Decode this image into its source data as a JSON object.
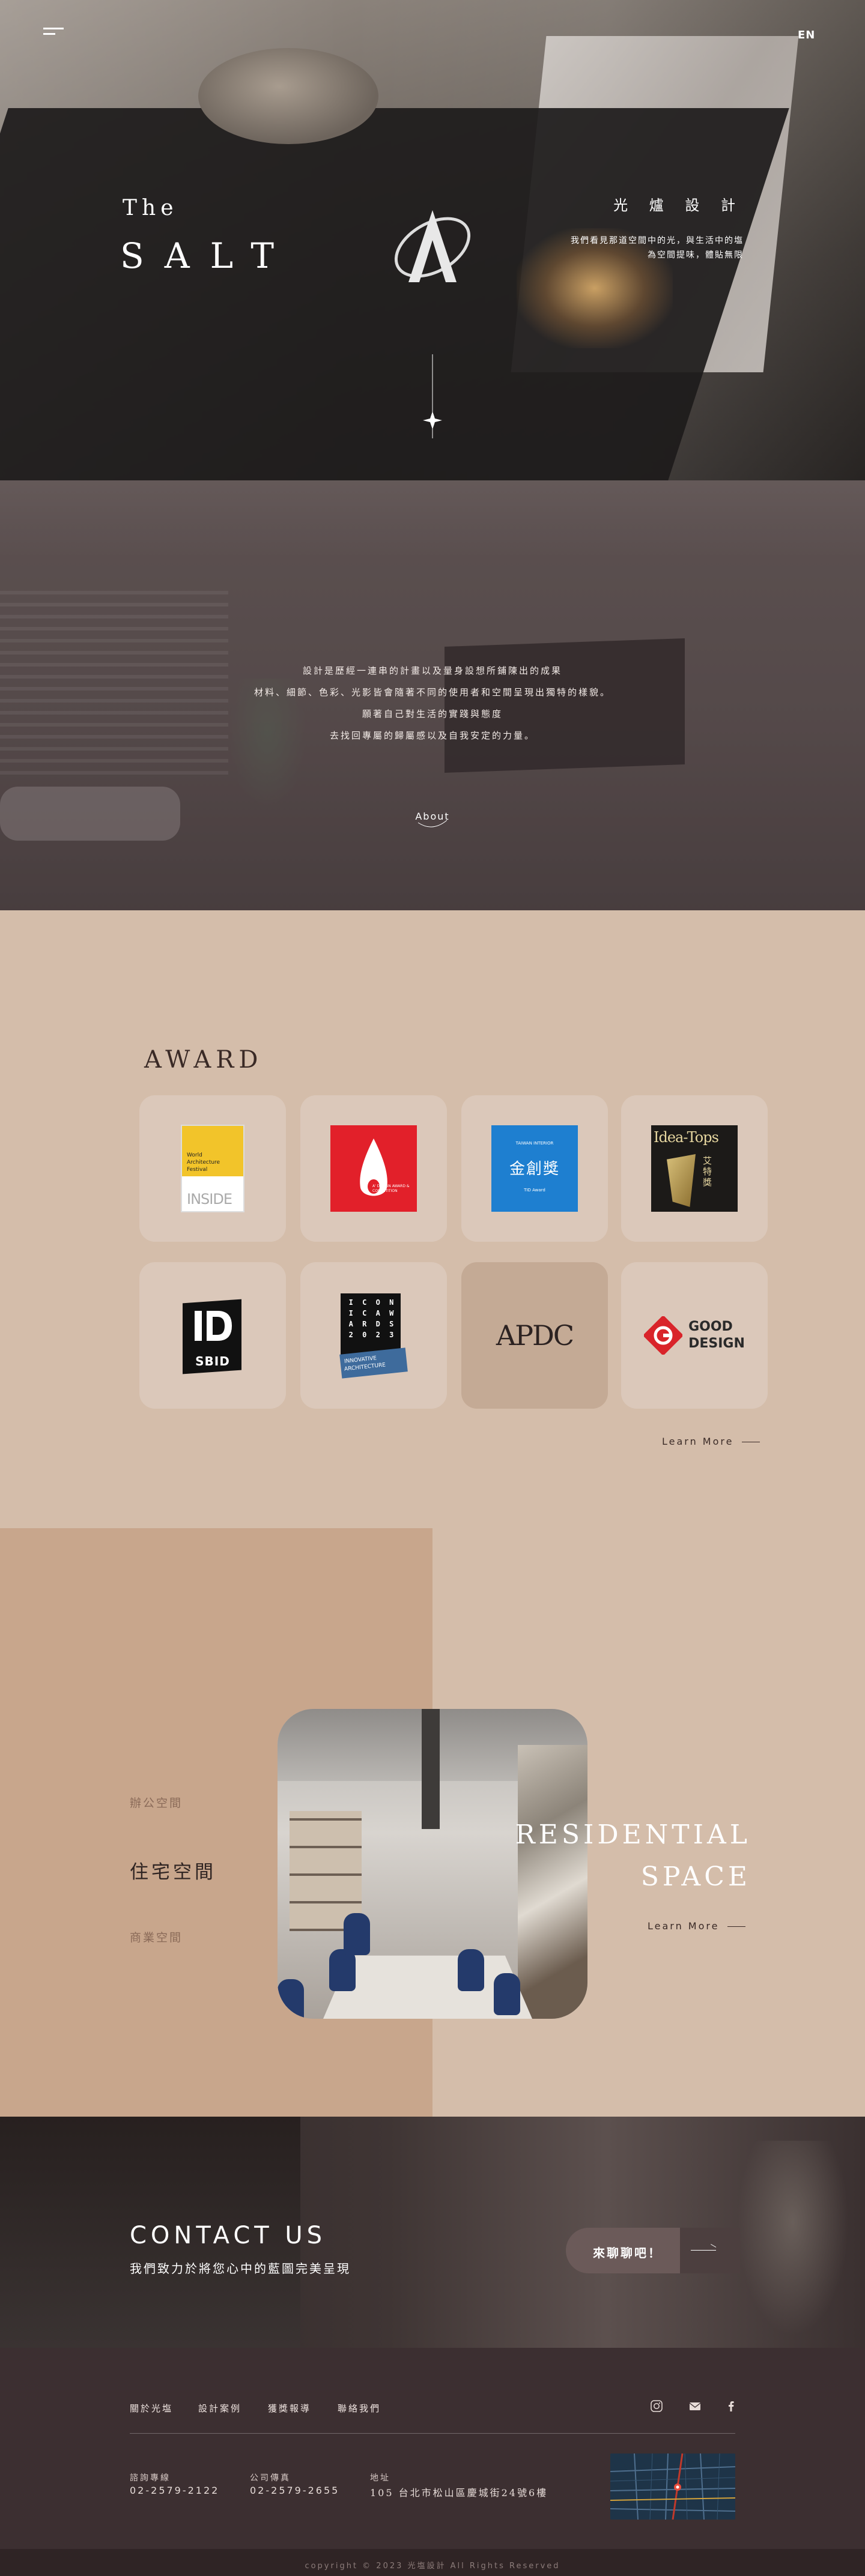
{
  "header": {
    "lang_label": "EN",
    "brand_the": "The",
    "brand_salt": "SALT",
    "cn_title": "光 爐 設 計",
    "cn_line1": "我們看見那道空間中的光，與生活中的塩",
    "cn_line2": "為空間提味，體貼無限"
  },
  "about": {
    "lines": [
      "設計是歷經一連串的計畫以及量身設想所鋪陳出的成果",
      "材料、細節、色彩、光影皆會隨著不同的使用者和空間呈現出獨特的樣貌。",
      "願著自己對生活的實踐與態度",
      "去找回專屬的歸屬感以及自我安定的力量。"
    ],
    "link_label": "About"
  },
  "award": {
    "title": "AWARD",
    "learn_more": "Learn More",
    "items": [
      {
        "name": "INSIDE World Architecture Festival",
        "line1": "World",
        "line2": "Architecture",
        "line3": "Festival",
        "mark": "INSIDE"
      },
      {
        "name": "A' Design Award",
        "caption": "A' DESIGN AWARD & COMPETITION"
      },
      {
        "name": "TID Award",
        "line1": "TAIWAN INTERIOR",
        "line2": "金創獎",
        "line3": "TID Award"
      },
      {
        "name": "Idea-Tops",
        "title": "Idea-Tops",
        "sub": "艾特獎"
      },
      {
        "name": "SBID",
        "mark": "SBID"
      },
      {
        "name": "Iconic Awards",
        "letters": [
          "I",
          "C",
          "O",
          "N",
          "I",
          "C",
          "A",
          "W",
          "A",
          "R",
          "D",
          "S",
          "2",
          "0",
          "2",
          "3"
        ],
        "banner1": "INNOVATIVE",
        "banner2": "ARCHITECTURE"
      },
      {
        "name": "APDC",
        "mark": "APDC"
      },
      {
        "name": "Good Design",
        "line1": "GOOD",
        "line2": "DESIGN"
      }
    ]
  },
  "spaces": {
    "nav": [
      "辦公空間",
      "住宅空間",
      "商業空間"
    ],
    "active_en_line1": "RESIDENTIAL",
    "active_en_line2": "SPACE",
    "learn_more": "Learn More"
  },
  "contact": {
    "title": "CONTACT US",
    "subtitle": "我們致力於將您心中的藍圖完美呈現",
    "button_label": "來聊聊吧！"
  },
  "footer": {
    "nav": [
      "關於光塩",
      "設計案例",
      "獲獎報導",
      "聯絡我們"
    ],
    "icons": [
      "instagram-icon",
      "mail-icon",
      "facebook-icon"
    ],
    "phone_label": "諮詢專線",
    "phone_value": "02-2579-2122",
    "fax_label": "公司傳真",
    "fax_value": "02-2579-2655",
    "address_label": "地址",
    "address_value": "105 台北市松山區慶城街24號6樓",
    "copyright": "copyright © 2023 光塩設計 All Rights Reserved"
  },
  "colors": {
    "award_bg": "#d4bdaa",
    "card_bg": "#dbc8ba",
    "space_left": "#c8a68c",
    "footer_bg": "#3c2f31",
    "accent_red": "#e2202a",
    "accent_blue": "#1e7fd0"
  }
}
